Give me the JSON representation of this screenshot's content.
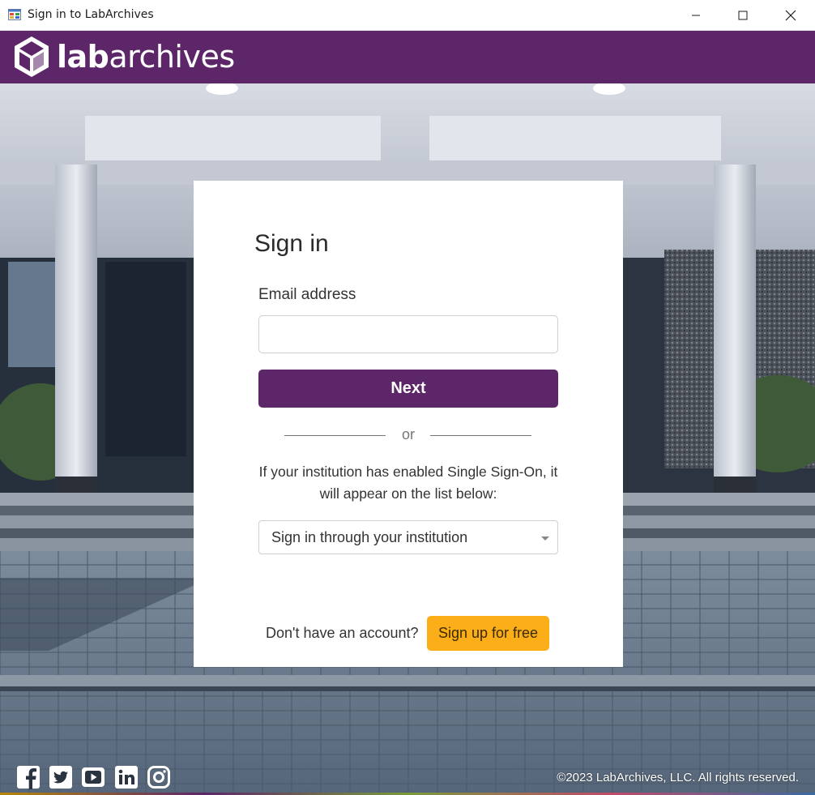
{
  "window": {
    "title": "Sign in to LabArchives",
    "icon": "app-window-icon",
    "controls": [
      "minimize-icon",
      "maximize-icon",
      "close-icon"
    ]
  },
  "brand": {
    "logo_bold": "lab",
    "logo_regular": "archives",
    "color": "#5c2669"
  },
  "signin": {
    "title": "Sign in",
    "email_label": "Email address",
    "email_value": "",
    "next_label": "Next",
    "or_label": "or",
    "sso_text": "If your institution has enabled Single Sign-On, it will appear on the list below:",
    "institution_select": "Sign in through your institution",
    "no_account_text": "Don't have an account?",
    "signup_label": "Sign up for free"
  },
  "footer": {
    "social_icons": [
      "facebook-icon",
      "twitter-icon",
      "youtube-icon",
      "linkedin-icon",
      "instagram-icon"
    ],
    "copyright": "©2023 LabArchives, LLC. All rights reserved."
  },
  "colors": {
    "accent_purple": "#5c2669",
    "signup_yellow": "#fbae17"
  }
}
